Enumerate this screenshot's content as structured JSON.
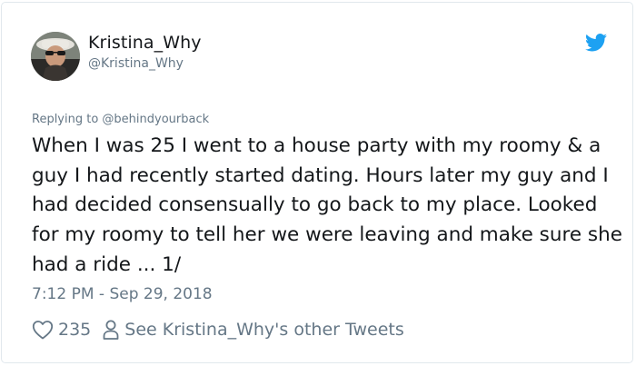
{
  "user": {
    "display_name": "Kristina_Why",
    "handle": "@Kristina_Why",
    "avatar_icon": "user-avatar-photo"
  },
  "tweet": {
    "reply_context": "Replying to @behindyourback",
    "text": "When I was 25 I went to a house party with my roomy & a guy I had recently started dating. Hours later my guy and I had decided consensually to go back to my place. Looked for my roomy to tell her we were leaving and make sure she had a ride ... 1/",
    "timestamp": "7:12 PM - Sep 29, 2018"
  },
  "actions": {
    "like_count": "235",
    "like_icon": "heart-icon",
    "profile_icon": "person-icon",
    "other_tweets_label": "See Kristina_Why's other Tweets"
  },
  "colors": {
    "twitter_blue": "#1da1f2",
    "text_primary": "#14171a",
    "text_secondary": "#657786",
    "border": "#e1e8ed"
  }
}
